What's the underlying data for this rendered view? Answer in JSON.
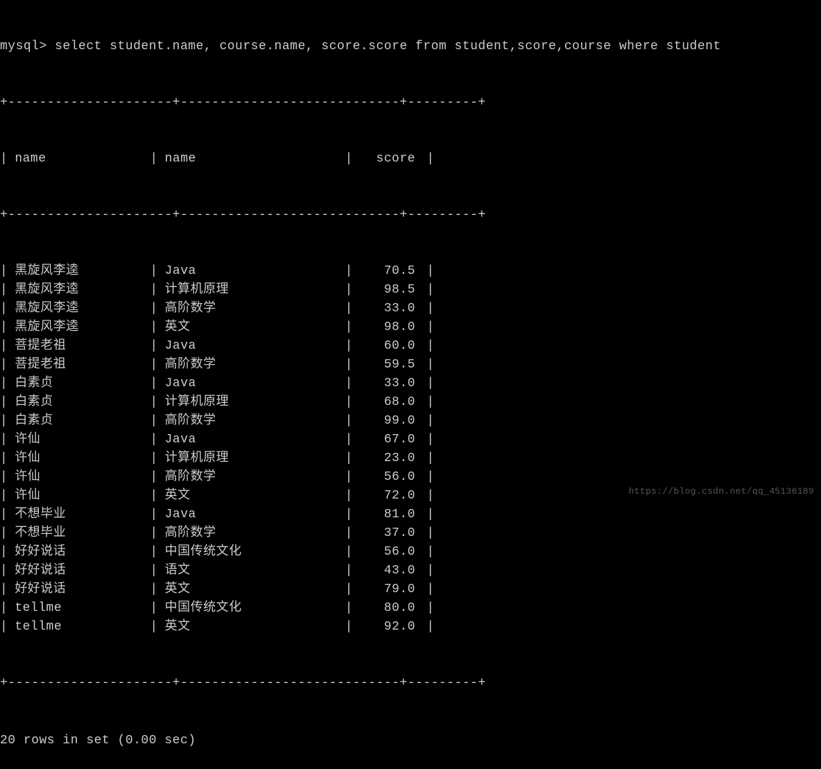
{
  "prompt": "mysql> select student.name, course.name, score.score from student,score,course where student",
  "border_top": "+---------------------+----------------------------+---------+",
  "headers": {
    "col1": "name",
    "col2": "name",
    "col3": "score"
  },
  "rows": [
    {
      "name": "黑旋风李逵",
      "course": "Java",
      "score": "70.5"
    },
    {
      "name": "黑旋风李逵",
      "course": "计算机原理",
      "score": "98.5"
    },
    {
      "name": "黑旋风李逵",
      "course": "高阶数学",
      "score": "33.0"
    },
    {
      "name": "黑旋风李逵",
      "course": "英文",
      "score": "98.0"
    },
    {
      "name": "菩提老祖",
      "course": "Java",
      "score": "60.0"
    },
    {
      "name": "菩提老祖",
      "course": "高阶数学",
      "score": "59.5"
    },
    {
      "name": "白素贞",
      "course": "Java",
      "score": "33.0"
    },
    {
      "name": "白素贞",
      "course": "计算机原理",
      "score": "68.0"
    },
    {
      "name": "白素贞",
      "course": "高阶数学",
      "score": "99.0"
    },
    {
      "name": "许仙",
      "course": "Java",
      "score": "67.0"
    },
    {
      "name": "许仙",
      "course": "计算机原理",
      "score": "23.0"
    },
    {
      "name": "许仙",
      "course": "高阶数学",
      "score": "56.0"
    },
    {
      "name": "许仙",
      "course": "英文",
      "score": "72.0"
    },
    {
      "name": "不想毕业",
      "course": "Java",
      "score": "81.0"
    },
    {
      "name": "不想毕业",
      "course": "高阶数学",
      "score": "37.0"
    },
    {
      "name": "好好说话",
      "course": "中国传统文化",
      "score": "56.0"
    },
    {
      "name": "好好说话",
      "course": "语文",
      "score": "43.0"
    },
    {
      "name": "好好说话",
      "course": "英文",
      "score": "79.0"
    },
    {
      "name": "tellme",
      "course": "中国传统文化",
      "score": "80.0"
    },
    {
      "name": "tellme",
      "course": "英文",
      "score": "92.0"
    }
  ],
  "footer": "20 rows in set (0.00 sec)",
  "watermark": "https://blog.csdn.net/qq_45136189"
}
